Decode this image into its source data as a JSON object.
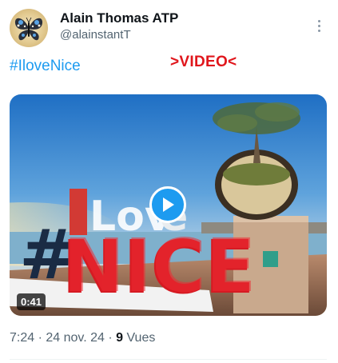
{
  "author": {
    "name": "Alain Thomas ATP",
    "handle": "@alainstantT",
    "avatar_icon": "butterfly-icon"
  },
  "post": {
    "hashtag": "#IloveNice",
    "video_label": ">VIDEO<"
  },
  "media": {
    "duration": "0:41",
    "play_icon": "play-icon"
  },
  "meta": {
    "time": "7:24",
    "sep1": " · ",
    "date": "24 nov. 24",
    "sep2": " · ",
    "views_count": "9",
    "views_label": " Vues"
  },
  "colors": {
    "link": "#1d9bf0",
    "video_label": "#e0161c",
    "secondary_text": "#536471"
  }
}
